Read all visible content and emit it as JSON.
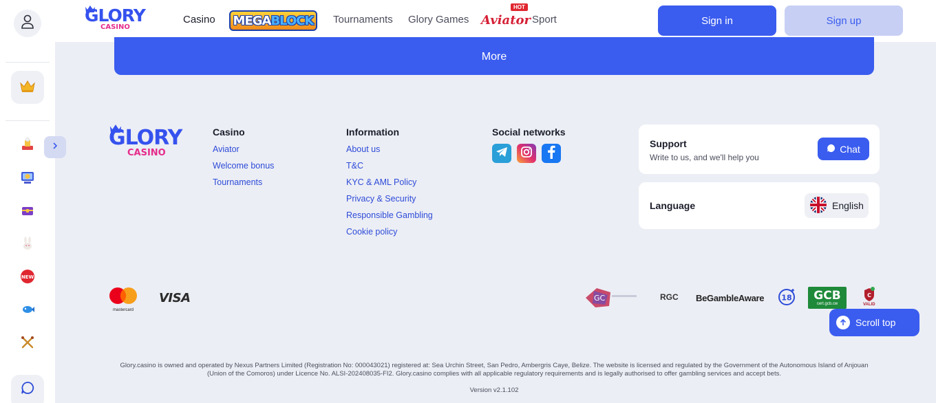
{
  "brand": {
    "logo_top": "GLORY",
    "logo_bottom": "CASINO"
  },
  "header": {
    "nav": [
      "Casino",
      "Tournaments",
      "Glory Games",
      "Sport"
    ],
    "megablock_left": "MEGA",
    "megablock_right": "BLOCK",
    "aviator": "Aviator",
    "hot_badge": "HOT",
    "sign_in": "Sign in",
    "sign_up": "Sign up",
    "active_nav": "Casino"
  },
  "rail": {
    "icons": [
      "profile-icon",
      "crown-icon",
      "game-icon",
      "slot-machine-icon",
      "treasure-chest-icon",
      "rabbit-icon",
      "new-badge-icon",
      "fish-icon",
      "crossed-swords-icon",
      "chat-icon"
    ]
  },
  "main": {
    "more_label": "More"
  },
  "footer": {
    "casino": {
      "title": "Casino",
      "links": [
        "Aviator",
        "Welcome bonus",
        "Tournaments"
      ]
    },
    "information": {
      "title": "Information",
      "links": [
        "About us",
        "T&C",
        "KYC & AML Policy",
        "Privacy & Security",
        "Responsible Gambling",
        "Cookie policy"
      ]
    },
    "social": {
      "title": "Social networks",
      "networks": [
        "telegram-icon",
        "instagram-icon",
        "facebook-icon"
      ]
    },
    "support": {
      "title": "Support",
      "subtitle": "Write to us, and we'll help you",
      "chat_label": "Chat"
    },
    "language": {
      "title": "Language",
      "current": "English"
    },
    "payments": {
      "mastercard_label": "mastercard",
      "visa_label": "VISA"
    },
    "licences": {
      "rgc": "RGC",
      "gamble_aware": "BeGambleAware",
      "age": "18",
      "gcb": "GCB",
      "gcb_sub": "cert.gcb.cw",
      "valid": "VALID",
      "gc": "GC"
    },
    "scroll_top": "Scroll top",
    "legal": "Glory.casino is owned and operated by Nexus Partners Limited (Registration No: 000043021) registered at: Sea Urchin Street, San Pedro, Ambergris Caye, Belize. The website is licensed and regulated by the Government of the Autonomous Island of Anjouan (Union of the Comoros) under Licence No. ALSI-202408035-FI2. Glory.casino complies with all applicable regulatory requirements and is legally authorised to offer gambling services and accept bets.",
    "version": "Version v2.1.102"
  },
  "colors": {
    "accent": "#3a5cef",
    "accent_light": "#c7cff4",
    "page_bg": "#eceef5",
    "logo_pink": "#e52c8b"
  }
}
